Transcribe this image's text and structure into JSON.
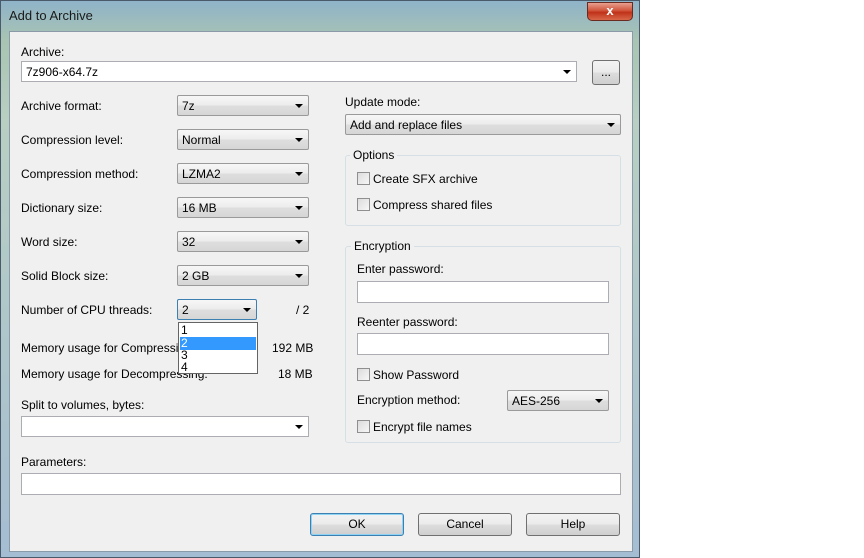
{
  "window": {
    "title": "Add to Archive",
    "close_label": "x"
  },
  "archive": {
    "label": "Archive:",
    "value": "7z906-x64.7z",
    "browse_label": "..."
  },
  "archive_format": {
    "label": "Archive format:",
    "value": "7z"
  },
  "compression_level": {
    "label": "Compression level:",
    "value": "Normal"
  },
  "compression_method": {
    "label": "Compression method:",
    "value": "LZMA2"
  },
  "dictionary_size": {
    "label": "Dictionary size:",
    "value": "16 MB"
  },
  "word_size": {
    "label": "Word size:",
    "value": "32"
  },
  "solid_block_size": {
    "label": "Solid Block size:",
    "value": "2 GB"
  },
  "cpu_threads": {
    "label": "Number of CPU threads:",
    "value": "2",
    "max_label": "/ 2",
    "options": [
      "1",
      "2",
      "3",
      "4"
    ],
    "selected_index": 1
  },
  "memory_compress": {
    "label": "Memory usage for Compressing:",
    "value": "192 MB"
  },
  "memory_decompress": {
    "label": "Memory usage for Decompressing:",
    "value": "18 MB"
  },
  "split_volumes": {
    "label": "Split to volumes, bytes:",
    "value": ""
  },
  "parameters": {
    "label": "Parameters:",
    "value": ""
  },
  "update_mode": {
    "label": "Update mode:",
    "value": "Add and replace files"
  },
  "options": {
    "title": "Options",
    "create_sfx": {
      "label": "Create SFX archive",
      "checked": false
    },
    "compress_shared": {
      "label": "Compress shared files",
      "checked": false
    }
  },
  "encryption": {
    "title": "Encryption",
    "enter_password_label": "Enter password:",
    "reenter_password_label": "Reenter password:",
    "show_password": {
      "label": "Show Password",
      "checked": false
    },
    "method_label": "Encryption method:",
    "method_value": "AES-256",
    "encrypt_names": {
      "label": "Encrypt file names",
      "checked": false
    }
  },
  "buttons": {
    "ok": "OK",
    "cancel": "Cancel",
    "help": "Help"
  }
}
